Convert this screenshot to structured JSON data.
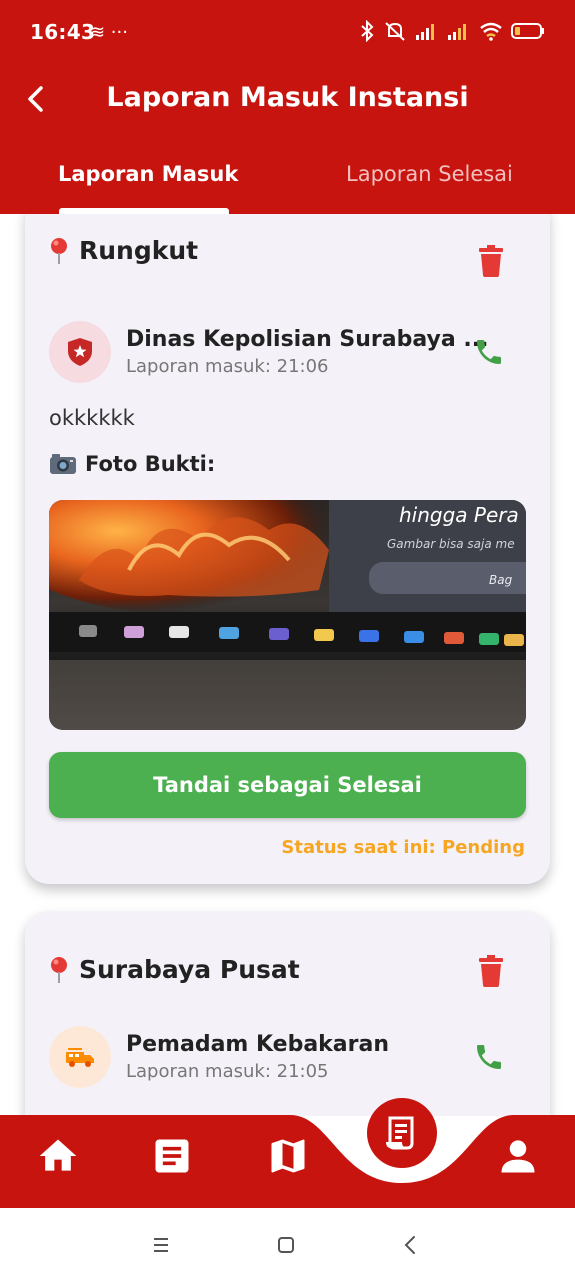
{
  "status_bar": {
    "time": "16:43",
    "left_icons": "≋ ···",
    "battery": "5"
  },
  "header": {
    "title": "Laporan Masuk Instansi",
    "tabs": [
      {
        "label": "Laporan Masuk",
        "active": true
      },
      {
        "label": "Laporan Selesai",
        "active": false
      }
    ]
  },
  "reports": [
    {
      "location": "Rungkut",
      "agency": "Dinas Kepolisian Surabaya ...",
      "time_label": "Laporan masuk: 21:06",
      "description": "okkkkkk",
      "photo_label": "Foto Bukti:",
      "photo_text_1": "hingga Pera",
      "photo_text_2": "Gambar bisa saja me",
      "photo_text_3": "Bag",
      "button_label": "Tandai sebagai Selesai",
      "status": "Status saat ini: Pending"
    },
    {
      "location": "Surabaya Pusat",
      "agency": "Pemadam Kebakaran",
      "time_label": "Laporan masuk: 21:05"
    }
  ],
  "bottom_nav": [
    {
      "icon": "home-icon"
    },
    {
      "icon": "article-icon"
    },
    {
      "icon": "map-icon"
    },
    {
      "icon": "report-icon",
      "active": true
    },
    {
      "icon": "person-icon"
    }
  ],
  "colors": {
    "primary": "#c8140f",
    "success": "#4caf50",
    "pending": "#f5a623",
    "card_bg": "#f4f1f9"
  }
}
